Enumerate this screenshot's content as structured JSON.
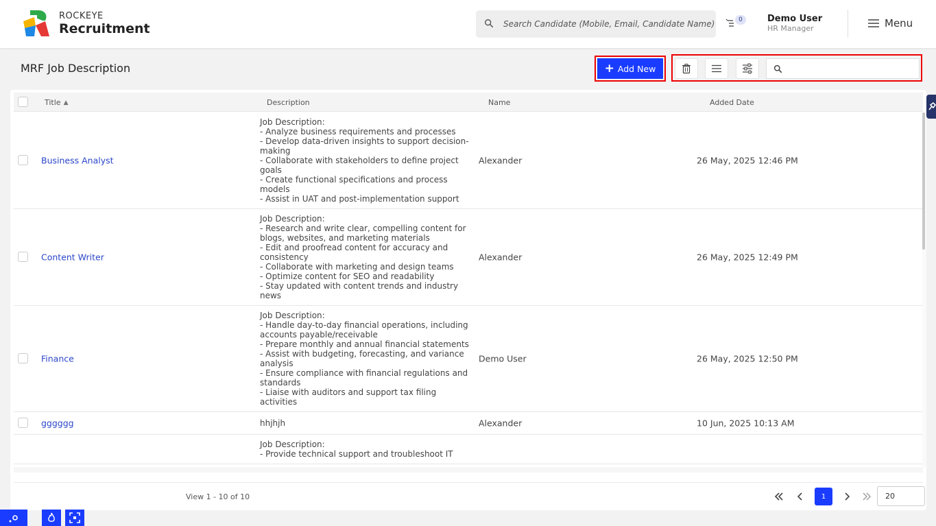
{
  "header": {
    "brand_small": "ROCKEYE",
    "brand_big": "Recruitment",
    "search_placeholder": "Search Candidate (Mobile, Email, Candidate Name)",
    "notification_count": "0",
    "user_name": "Demo User",
    "user_role": "HR Manager",
    "menu_label": "Menu"
  },
  "page": {
    "title": "MRF Job Description",
    "add_new_label": "Add New",
    "table_search_value": ""
  },
  "table": {
    "columns": {
      "title": "Title",
      "description": "Description",
      "name": "Name",
      "added_date": "Added Date"
    },
    "rows": [
      {
        "title": "Business Analyst",
        "description": "Job Description:\n- Analyze business requirements and processes\n- Develop data-driven insights to support decision-making\n- Collaborate with stakeholders to define project goals\n- Create functional specifications and process models\n- Assist in UAT and post-implementation support",
        "name": "Alexander",
        "added_date": "26 May, 2025 12:46 PM"
      },
      {
        "title": "Content Writer",
        "description": "Job Description:\n- Research and write clear, compelling content for blogs, websites, and marketing materials\n- Edit and proofread content for accuracy and consistency\n- Collaborate with marketing and design teams\n- Optimize content for SEO and readability\n- Stay updated with content trends and industry news",
        "name": "Alexander",
        "added_date": "26 May, 2025 12:49 PM"
      },
      {
        "title": "Finance",
        "description": "Job Description:\n- Handle day-to-day financial operations, including accounts payable/receivable\n- Prepare monthly and annual financial statements\n- Assist with budgeting, forecasting, and variance analysis\n- Ensure compliance with financial regulations and standards\n- Liaise with auditors and support tax filing activities",
        "name": "Demo User",
        "added_date": "26 May, 2025 12:50 PM"
      },
      {
        "title": "gggggg",
        "description": "hhjhjh",
        "name": "Alexander",
        "added_date": "10 Jun, 2025 10:13 AM"
      },
      {
        "title": "",
        "description": "Job Description:\n- Provide technical support and troubleshoot IT",
        "name": "",
        "added_date": ""
      }
    ]
  },
  "pager": {
    "view_text": "View 1 - 10 of 10",
    "current_page": "1",
    "page_size": "20"
  },
  "icons": [
    "search-icon",
    "notification-list-icon",
    "hamburger-icon",
    "plus-icon",
    "trash-icon",
    "columns-icon",
    "filter-sliders-icon",
    "table-search-icon",
    "sort-asc-icon",
    "first-page-icon",
    "prev-page-icon",
    "next-page-icon",
    "last-page-icon",
    "side-pin-icon",
    "settings-icon",
    "fire-icon",
    "fullscreen-icon"
  ],
  "colors": {
    "accent": "#1a3cff",
    "highlight_border": "#ee0000",
    "link": "#2c46c8",
    "side_tab": "#273469"
  }
}
